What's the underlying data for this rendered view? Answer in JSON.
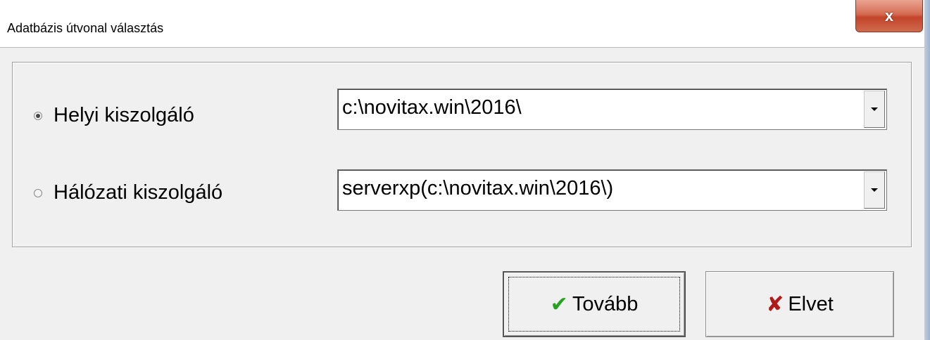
{
  "window": {
    "title": "Adatbázis útvonal választás",
    "close_label": "x"
  },
  "options": [
    {
      "label": "Helyi kiszolgáló",
      "selected": true,
      "path": "c:\\novitax.win\\2016\\"
    },
    {
      "label": "Hálózati kiszolgáló",
      "selected": false,
      "path": "serverxp(c:\\novitax.win\\2016\\)"
    }
  ],
  "buttons": {
    "ok_label": "Tovább",
    "ok_icon": "check-icon",
    "cancel_label": "Elvet",
    "cancel_icon": "cross-icon"
  },
  "colors": {
    "check": "#25a321",
    "cross": "#b01a1a",
    "close_button": "#c2442a"
  }
}
